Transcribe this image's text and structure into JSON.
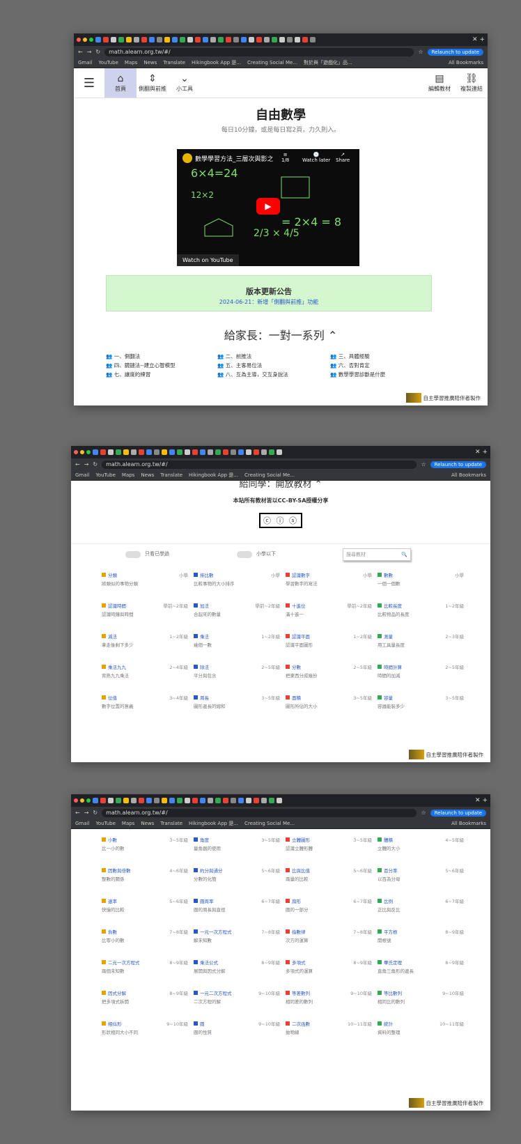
{
  "browser": {
    "url": "math.alearn.org.tw/#/",
    "relaunch": "Relaunch to update",
    "bookmarks": [
      "Gmail",
      "YouTube",
      "Maps",
      "News",
      "Translate",
      "Hikingbook App 是...",
      "Creating Social Me...",
      "對於與「遊戲化」品...",
      "All Bookmarks"
    ]
  },
  "nav": {
    "menu": "☰",
    "home": "首頁",
    "sidebar": "側翻與前推",
    "tools": "小工具",
    "compose": "編輯教材",
    "copy": "複製連結"
  },
  "hero": {
    "title": "自由數學",
    "subtitle": "每日10分鐘，或是每日寫2頁，力久則入。"
  },
  "video": {
    "title": "數學學習方法_三層次與影之",
    "counter": "1/8",
    "watch_later": "Watch later",
    "share": "Share",
    "watch_on": "Watch on YouTube"
  },
  "notice": {
    "title": "版本更新公告",
    "date_text": "2024-06-21：新增「側翻與前推」功能"
  },
  "parents": {
    "title": "給家長：一對一系列",
    "items": [
      "一、側翻法",
      "二、前推法",
      "三、具體經驗",
      "四、鏡鏈法--建立心智模型",
      "五、主客易位法",
      "六、否對肯定",
      "七、讓度的練習",
      "八、互為主導，交互身說法",
      "數學學習診斷是什麼"
    ]
  },
  "badge": "自主學習推廣陪伴者製作",
  "students": {
    "title": "給同學：開放教材",
    "license": "本站所有教材皆以CC-BY-SA授權分享",
    "cc": "ⓒ ⓘ ⓢ"
  },
  "filters": {
    "toggle1": "只看已學過",
    "toggle2": "小學以下",
    "search_placeholder": "搜尋教材",
    "search_icon": "🔍"
  },
  "cards_page2": [
    {
      "title": "分類",
      "grade": "小學",
      "desc": "將類似的事物分類"
    },
    {
      "title": "排比數",
      "grade": "小學",
      "desc": "比較事物的大小排序"
    },
    {
      "title": "認識數字",
      "grade": "小學",
      "desc": "學習數字的寫法"
    },
    {
      "title": "數數",
      "grade": "小學",
      "desc": "一個一個數"
    },
    {
      "title": "認識時間",
      "grade": "學前~2年級",
      "desc": "認識時鐘與時間"
    },
    {
      "title": "加法",
      "grade": "學前~2年級",
      "desc": "合起來的數量"
    },
    {
      "title": "十進位",
      "grade": "學前~2年級",
      "desc": "滿十進一"
    },
    {
      "title": "比較長度",
      "grade": "1~2年級",
      "desc": "比較物品的長度"
    },
    {
      "title": "減法",
      "grade": "1~2年級",
      "desc": "拿走後剩下多少"
    },
    {
      "title": "乘法",
      "grade": "1~2年級",
      "desc": "幾個一數"
    },
    {
      "title": "認識平面",
      "grade": "1~2年級",
      "desc": "認識平面圖形"
    },
    {
      "title": "測量",
      "grade": "2~3年級",
      "desc": "用工具量長度"
    },
    {
      "title": "乘法九九",
      "grade": "2~4年級",
      "desc": "背熟九九乘法"
    },
    {
      "title": "除法",
      "grade": "2~5年級",
      "desc": "平分與包含"
    },
    {
      "title": "分數",
      "grade": "2~5年級",
      "desc": "把東西分成幾份"
    },
    {
      "title": "時間計算",
      "grade": "2~5年級",
      "desc": "時間的加減"
    },
    {
      "title": "位值",
      "grade": "3~4年級",
      "desc": "數字位置的意義"
    },
    {
      "title": "周長",
      "grade": "3~5年級",
      "desc": "圖形邊長的總和"
    },
    {
      "title": "面積",
      "grade": "3~5年級",
      "desc": "圖形所佔的大小"
    },
    {
      "title": "容量",
      "grade": "3~5年級",
      "desc": "容器能裝多少"
    }
  ],
  "cards_page3": [
    {
      "title": "小數",
      "grade": "3~5年級",
      "desc": "比一小的數"
    },
    {
      "title": "角度",
      "grade": "3~5年級",
      "desc": "量角器的使用"
    },
    {
      "title": "立體圖形",
      "grade": "3~5年級",
      "desc": "認識立體形體"
    },
    {
      "title": "體積",
      "grade": "4~5年級",
      "desc": "立體的大小"
    },
    {
      "title": "因數與倍數",
      "grade": "4~6年級",
      "desc": "整數的關係"
    },
    {
      "title": "約分與通分",
      "grade": "5~6年級",
      "desc": "分數的化簡"
    },
    {
      "title": "比與比值",
      "grade": "5~6年級",
      "desc": "兩量的比較"
    },
    {
      "title": "百分率",
      "grade": "5~6年級",
      "desc": "以百為分母"
    },
    {
      "title": "速率",
      "grade": "5~6年級",
      "desc": "快慢的比較"
    },
    {
      "title": "圓周率",
      "grade": "6~7年級",
      "desc": "圓的周長與直徑"
    },
    {
      "title": "扇形",
      "grade": "6~7年級",
      "desc": "圓的一部分"
    },
    {
      "title": "比例",
      "grade": "6~7年級",
      "desc": "正比與反比"
    },
    {
      "title": "負數",
      "grade": "7~8年級",
      "desc": "比零小的數"
    },
    {
      "title": "一元一次方程式",
      "grade": "7~8年級",
      "desc": "解未知數"
    },
    {
      "title": "指數律",
      "grade": "7~8年級",
      "desc": "次方的運算"
    },
    {
      "title": "平方根",
      "grade": "8~9年級",
      "desc": "開根號"
    },
    {
      "title": "二元一次方程式",
      "grade": "8~9年級",
      "desc": "兩個未知數"
    },
    {
      "title": "乘法公式",
      "grade": "8~9年級",
      "desc": "展開與因式分解"
    },
    {
      "title": "多項式",
      "grade": "8~9年級",
      "desc": "多項式的運算"
    },
    {
      "title": "畢氏定理",
      "grade": "8~9年級",
      "desc": "直角三角形的邊長"
    },
    {
      "title": "因式分解",
      "grade": "8~9年級",
      "desc": "把多項式拆開"
    },
    {
      "title": "一元二次方程式",
      "grade": "9~10年級",
      "desc": "二次方程的解"
    },
    {
      "title": "等差數列",
      "grade": "9~10年級",
      "desc": "相同差的數列"
    },
    {
      "title": "等比數列",
      "grade": "9~10年級",
      "desc": "相同比的數列"
    },
    {
      "title": "相似形",
      "grade": "9~10年級",
      "desc": "形狀相同大小不同"
    },
    {
      "title": "圓",
      "grade": "9~10年級",
      "desc": "圓的性質"
    },
    {
      "title": "二次函數",
      "grade": "10~11年級",
      "desc": "拋物線"
    },
    {
      "title": "統計",
      "grade": "10~11年級",
      "desc": "資料的整理"
    }
  ],
  "colors": {
    "active_tab": "#cfd2ec",
    "notice_bg": "#d4f7d0",
    "link": "#2a59c7",
    "tab_bar": "#202124"
  }
}
